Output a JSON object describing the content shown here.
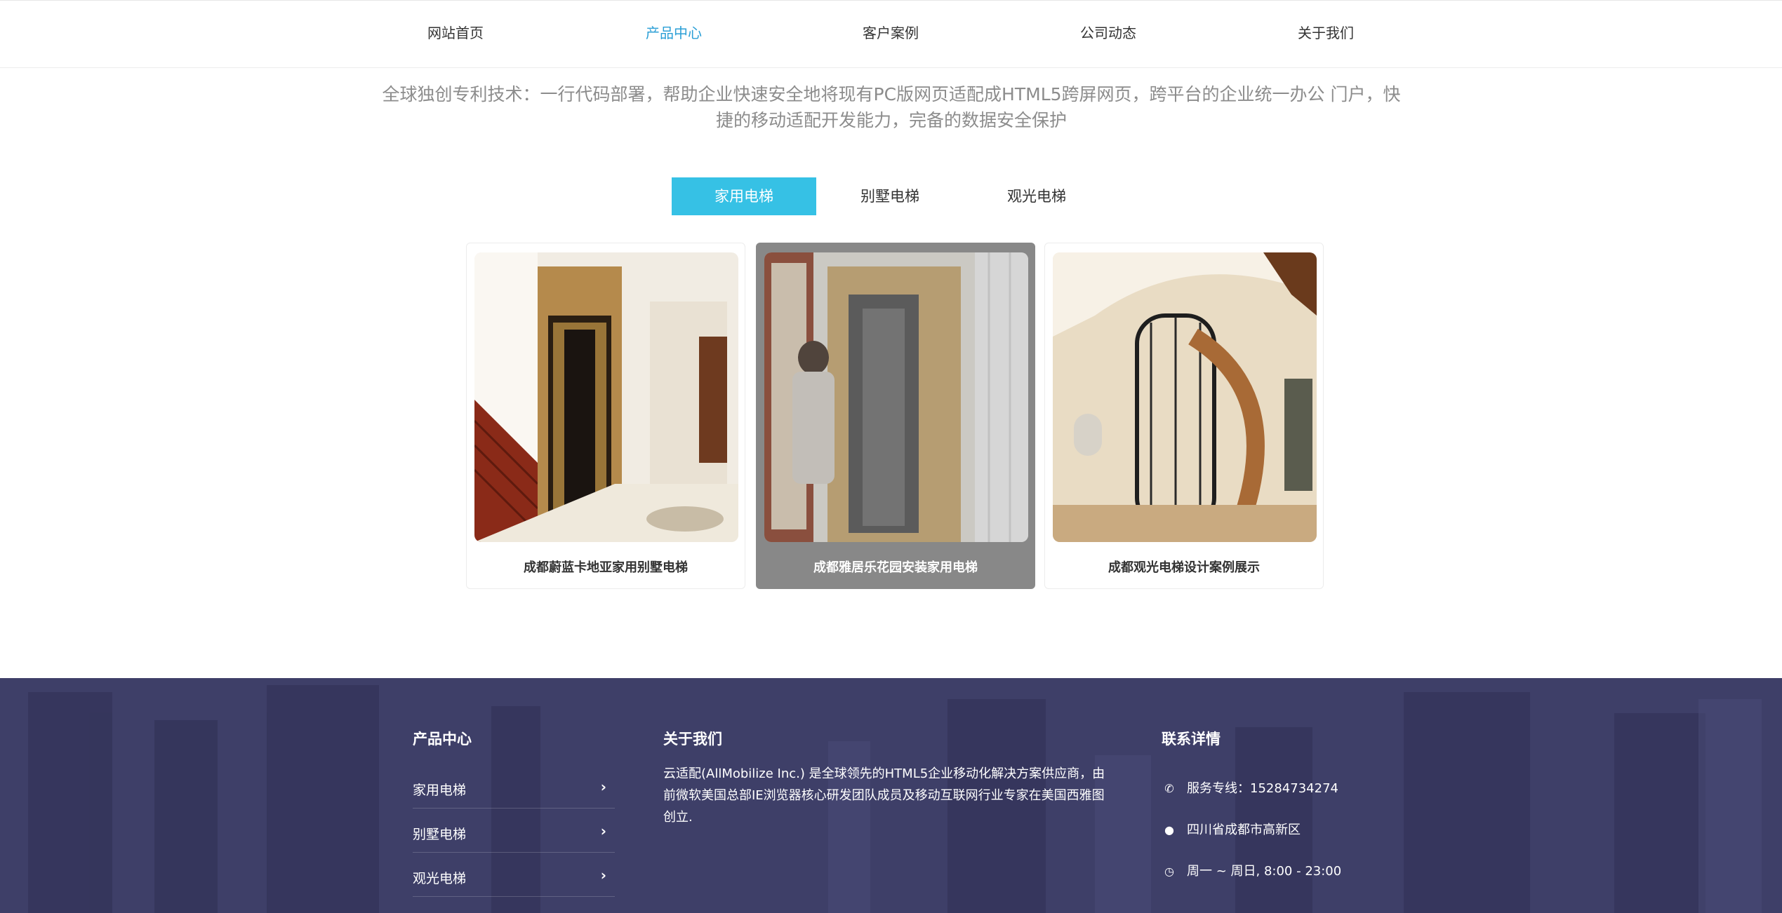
{
  "nav": {
    "items": [
      "网站首页",
      "产品中心",
      "客户案例",
      "公司动态",
      "关于我们"
    ],
    "active_index": 1,
    "active_color": "#2b9fd6"
  },
  "intro": {
    "line1": "全球独创专利技术：一行代码部署，帮助企业快速安全地将现有PC版网页适配成HTML5跨屏网页，跨平台的企业统一办公 门户，快",
    "line2": "捷的移动适配开发能力，完备的数据安全保护"
  },
  "tabs": {
    "items": [
      "家用电梯",
      "别墅电梯",
      "观光电梯"
    ],
    "active_index": 0,
    "active_color": "#36c1e5"
  },
  "products": [
    {
      "title": "成都蔚蓝卡地亚家用别墅电梯",
      "image": "home-elevator-staircase-photo"
    },
    {
      "title": "成都雅居乐花园安装家用电梯",
      "image": "elevator-installation-photo"
    },
    {
      "title": "成都观光电梯设计案例展示",
      "image": "glass-panoramic-elevator-photo"
    }
  ],
  "footer": {
    "products_title": "产品中心",
    "product_links": [
      "家用电梯",
      "别墅电梯",
      "观光电梯"
    ],
    "chevron": "›",
    "about_title": "关于我们",
    "about_text": "云适配(AllMobilize Inc.) 是全球领先的HTML5企业移动化解决方案供应商，由前微软美国总部IE浏览器核心研发团队成员及移动互联网行业专家在美国西雅图创立.",
    "contact_title": "联系详情",
    "phone": "服务专线：15284734274",
    "address": "四川省成都市高新区",
    "hours": "周一 ~ 周日, 8:00 - 23:00",
    "icons": [
      "phone-icon",
      "map-marker-icon",
      "clock-icon"
    ],
    "bg_color": "#3e3f68"
  }
}
